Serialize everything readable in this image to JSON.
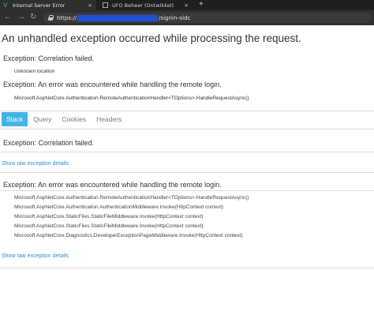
{
  "browser": {
    "tabs": [
      {
        "title": "Internal Server Error",
        "active": true
      },
      {
        "title": "UFO Beheer (Ontwikkel)",
        "active": false
      }
    ],
    "new_tab_symbol": "+",
    "close_symbol": "×",
    "back_symbol": "←",
    "forward_symbol": "→",
    "reload_symbol": "↻",
    "url_prefix": "https://",
    "url_suffix": "/signin-oidc"
  },
  "error": {
    "heading": "An unhandled exception occurred while processing the request.",
    "exception1": "Exception: Correlation failed.",
    "location": "Unknown location",
    "exception2": "Exception: An error was encountered while handling the remote login.",
    "method": "Microsoft.AspNetCore.Authentication.RemoteAuthenticationHandler<TOptions>.HandleRequestAsync()"
  },
  "detail_tabs": [
    "Stack",
    "Query",
    "Cookies",
    "Headers"
  ],
  "stack": {
    "section1_title": "Exception: Correlation failed.",
    "show_raw": "Show raw exception details",
    "section2_title": "Exception: An error was encountered while handling the remote login.",
    "frames": [
      "Microsoft.AspNetCore.Authentication.RemoteAuthenticationHandler<TOptions>.HandleRequestAsync()",
      "Microsoft.AspNetCore.Authentication.AuthenticationMiddleware.Invoke(HttpContext context)",
      "Microsoft.AspNetCore.StaticFiles.StaticFileMiddleware.Invoke(HttpContext context)",
      "Microsoft.AspNetCore.StaticFiles.StaticFileMiddleware.Invoke(HttpContext context)",
      "Microsoft.AspNetCore.Diagnostics.DeveloperExceptionPageMiddleware.Invoke(HttpContext context)"
    ],
    "show_raw_2": "Show raw exception details"
  },
  "colors": {
    "accent": "#41b4e6",
    "link": "#2a8fd6"
  }
}
